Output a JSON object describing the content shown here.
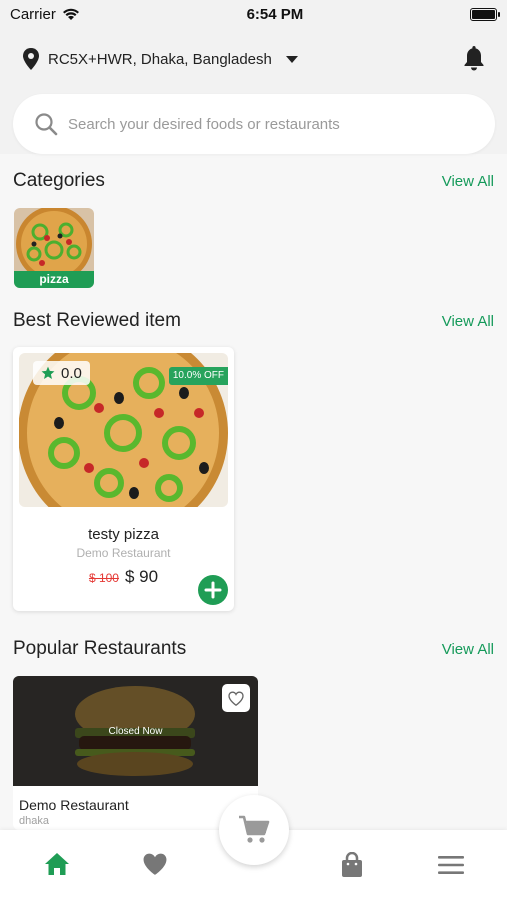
{
  "status_bar": {
    "carrier": "Carrier",
    "time": "6:54 PM"
  },
  "header": {
    "location": "RC5X+HWR, Dhaka, Bangladesh"
  },
  "search": {
    "placeholder": "Search your desired foods or restaurants"
  },
  "categories": {
    "title": "Categories",
    "view_all": "View All",
    "items": [
      {
        "label": "pizza"
      }
    ]
  },
  "best_reviewed": {
    "title": "Best Reviewed item",
    "view_all": "View All",
    "items": [
      {
        "rating": "0.0",
        "discount": "10.0% OFF",
        "name": "testy pizza",
        "restaurant": "Demo Restaurant",
        "old_price": "$ 100",
        "price": "$ 90"
      }
    ]
  },
  "popular_restaurants": {
    "title": "Popular Restaurants",
    "view_all": "View All",
    "items": [
      {
        "status": "Closed Now",
        "name": "Demo Restaurant",
        "address": "dhaka"
      }
    ]
  },
  "bottom_nav": {
    "items": [
      "home-icon",
      "heart-icon",
      "cart-icon",
      "bag-icon",
      "menu-icon"
    ],
    "active": "home-icon"
  },
  "colors": {
    "accent": "#1f9d55",
    "strike": "#e53935"
  }
}
